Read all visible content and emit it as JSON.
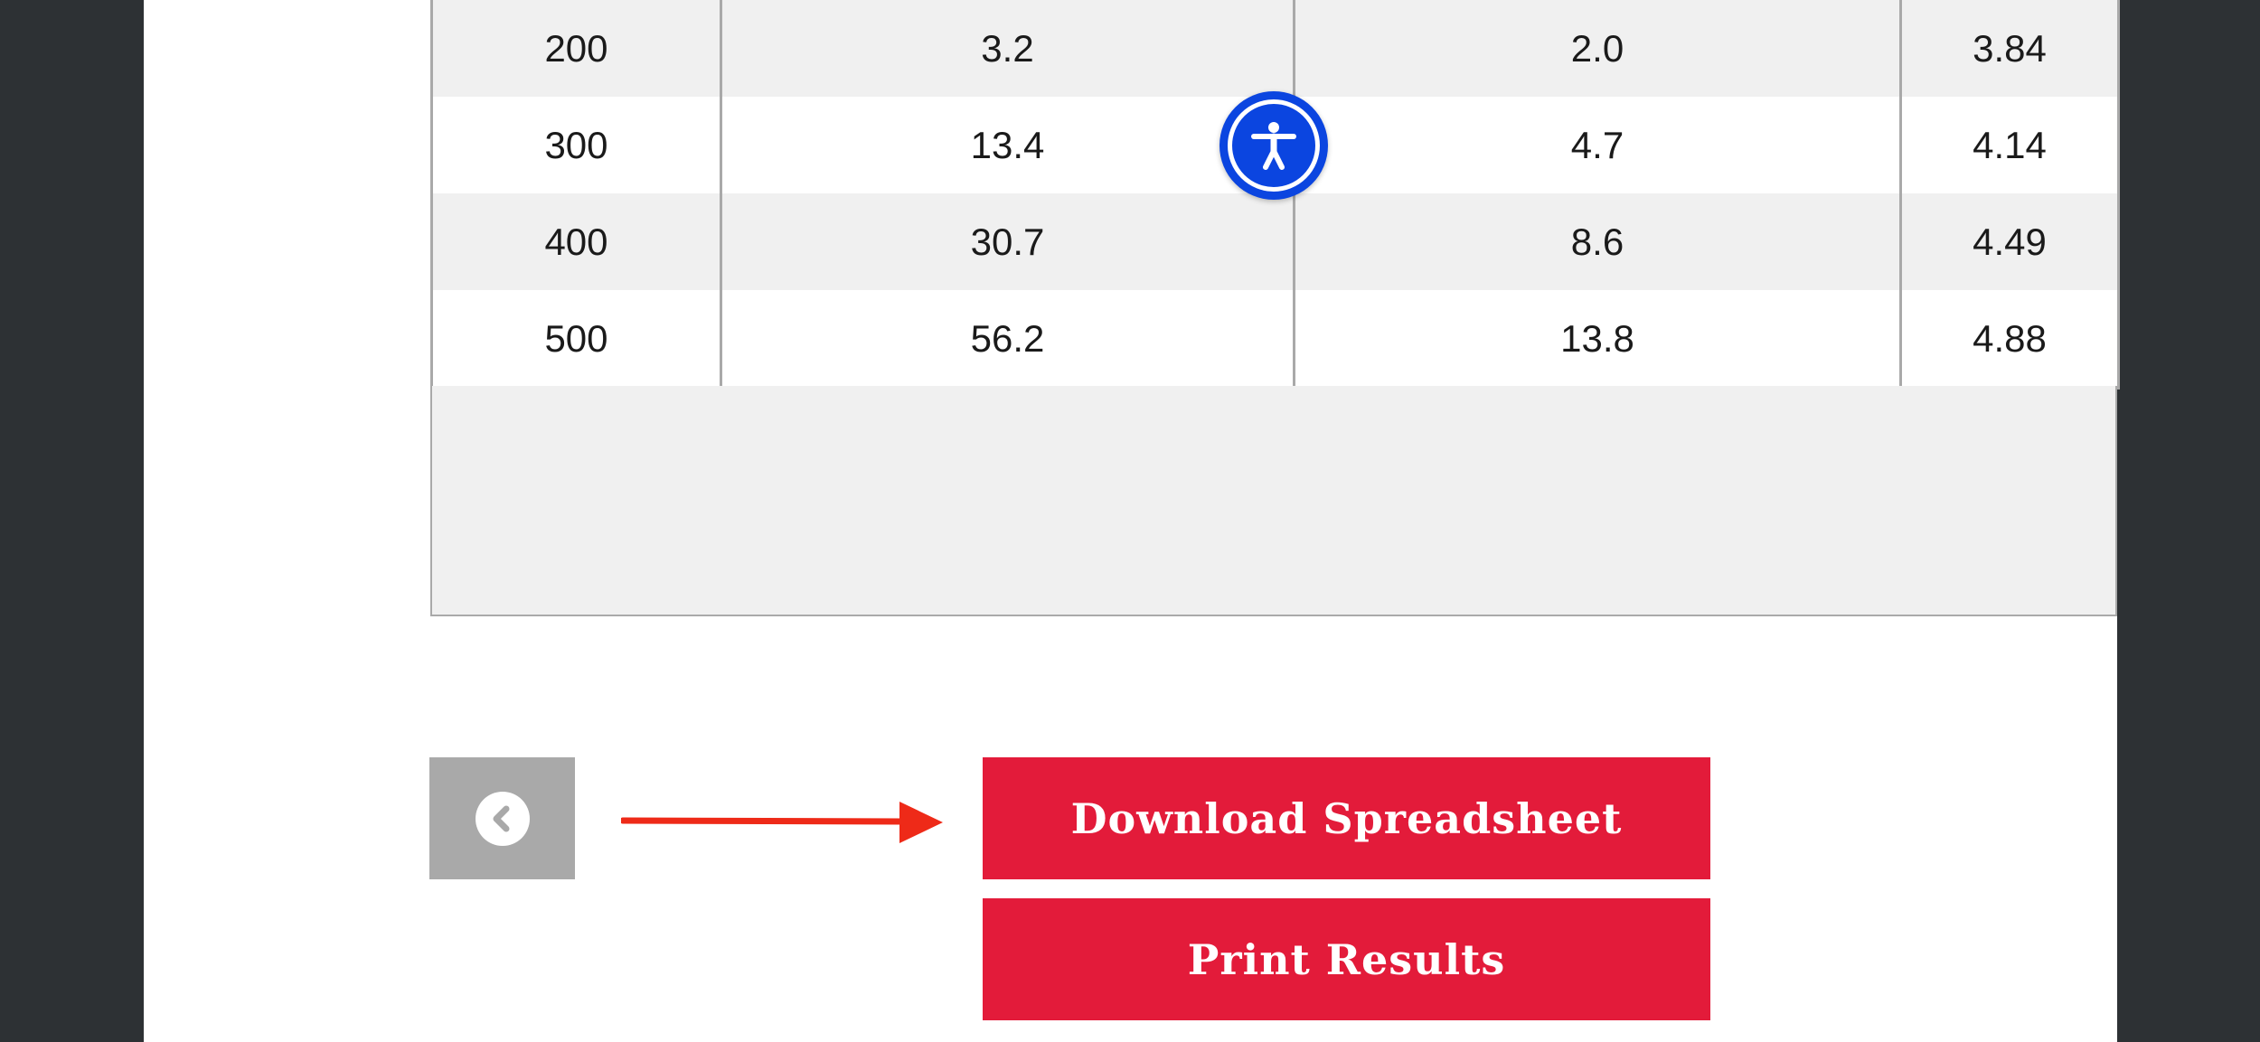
{
  "table": {
    "rows": [
      [
        "200",
        "3.2",
        "2.0",
        "3.84"
      ],
      [
        "300",
        "13.4",
        "4.7",
        "4.14"
      ],
      [
        "400",
        "30.7",
        "8.6",
        "4.49"
      ],
      [
        "500",
        "56.2",
        "13.8",
        "4.88"
      ]
    ]
  },
  "accessibility": {
    "icon": "accessibility-person-icon",
    "color": "#0b45e0"
  },
  "navigation": {
    "back_icon": "chevron-left-icon"
  },
  "actions": {
    "download_label": "Download Spreadsheet",
    "print_label": "Print Results",
    "accent_color": "#e31b3a"
  },
  "annotation": {
    "arrow_color": "#ee2a18"
  }
}
